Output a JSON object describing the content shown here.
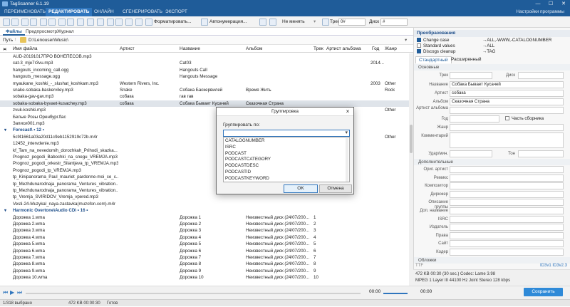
{
  "app": {
    "title": "TagScanner 6.1.19",
    "window_min": "—",
    "window_max": "☐",
    "window_close": "✕"
  },
  "menu": {
    "items": [
      "ПЕРЕИМЕНОВАТЬ",
      "РЕДАКТИРОВАТЬ",
      "ОНЛАЙН",
      "СГЕНЕРИРОВАТЬ",
      "ЭКСПОРТ"
    ],
    "active_index": 1,
    "settings": "Настройки программы"
  },
  "toolbar": {
    "format_label": "Форматировать...",
    "autonumber_label": "Автонумерация...",
    "no_change_label": "Не менять",
    "track_label": "Трек",
    "track_value": "0#",
    "disc_label": "Диск",
    "disc_value": "#"
  },
  "tabs": [
    "Файлы",
    "Предпросмотр",
    "Журнал"
  ],
  "path": {
    "label": "Путь",
    "value": "D:\\Lenouser\\Music\\"
  },
  "columns": [
    "Имя файла",
    "Артист",
    "Название",
    "Альбом",
    "Трек",
    "Артист альбома",
    "Год",
    "Жанр"
  ],
  "rows": [
    {
      "t": "f",
      "name": "AUD-20191017ПРО ВОНЕПЕСОВ.mp3",
      "artist": "",
      "title": "",
      "album": "",
      "track": "",
      "aa": "",
      "year": "",
      "genre": ""
    },
    {
      "t": "f",
      "name": "cat-3_mje7r3vu.mp3",
      "artist": "",
      "title": "Cat03",
      "album": "",
      "track": "",
      "aa": "",
      "year": "2014...",
      "genre": ""
    },
    {
      "t": "f",
      "name": "hangouts_incoming_call.ogg",
      "artist": "",
      "title": "Hangouts Call",
      "album": "",
      "track": "",
      "aa": "",
      "year": "",
      "genre": ""
    },
    {
      "t": "f",
      "name": "hangouts_message.ogg",
      "artist": "",
      "title": "Hangouts Message",
      "album": "",
      "track": "",
      "aa": "",
      "year": "",
      "genre": ""
    },
    {
      "t": "f",
      "name": "myaukane_koshki_-_slushat_koshkam.mp3",
      "artist": "Western Rivers, Inc.",
      "title": "",
      "album": "",
      "track": "",
      "aa": "",
      "year": "2003",
      "genre": "Other"
    },
    {
      "t": "f",
      "name": "snake-sobaka-baskerviley.mp3",
      "artist": "Snake",
      "title": "Собака Баскервилей",
      "album": "Время Жить",
      "track": "",
      "aa": "",
      "year": "",
      "genre": "Rock"
    },
    {
      "t": "f",
      "name": "sobaka-gav-gav.mp3",
      "artist": "собака",
      "title": "гав гав",
      "album": "",
      "track": "",
      "aa": "",
      "year": "",
      "genre": ""
    },
    {
      "t": "s",
      "name": "sobaka-sobaka-byvaet-kusachey.mp3",
      "artist": "собака",
      "title": "Собака Бывает Кусачей",
      "album": "Сказочная Страна",
      "track": "",
      "aa": "",
      "year": "",
      "genre": ""
    },
    {
      "t": "f",
      "name": "zvuk-koshki.mp3",
      "artist": "",
      "title": "",
      "album": "",
      "track": "",
      "aa": "",
      "year": "",
      "genre": "Other"
    },
    {
      "t": "f",
      "name": "Белые Розы Оренбург.flac",
      "artist": "",
      "title": "",
      "album": "",
      "track": "",
      "aa": "",
      "year": "",
      "genre": ""
    },
    {
      "t": "f",
      "name": "Записи001.mp3",
      "artist": "",
      "title": "",
      "album": "",
      "track": "",
      "aa": "",
      "year": "",
      "genre": ""
    },
    {
      "t": "g",
      "name": "Forecast\\ • 12 •",
      "artist": "",
      "title": "",
      "album": "",
      "track": "",
      "aa": "",
      "year": "",
      "genre": ""
    },
    {
      "t": "f",
      "name": "5cf41661a03a20d11c9eb1152919c72b.m4r",
      "artist": "",
      "title": "",
      "album": "",
      "track": "",
      "aa": "",
      "year": "",
      "genre": "Other"
    },
    {
      "t": "f",
      "name": "12452_intervdenie.mp3",
      "artist": "",
      "title": "",
      "album": "",
      "track": "",
      "aa": "",
      "year": "",
      "genre": ""
    },
    {
      "t": "f",
      "name": "kf_Tam_na_nevedomih_dorozhkah_Prihodi_skazka...",
      "artist": "",
      "title": "",
      "album": "",
      "track": "",
      "aa": "",
      "year": "",
      "genre": ""
    },
    {
      "t": "f",
      "name": "Prognoz_pogodi_Babochki_na_snegu_VREMJA.mp3",
      "artist": "",
      "title": "",
      "album": "",
      "track": "",
      "aa": "",
      "year": "",
      "genre": ""
    },
    {
      "t": "f",
      "name": "Prognoz_pogodi_orkestr_Silantjeva_tp_VREMJA.mp3",
      "artist": "",
      "title": "",
      "album": "",
      "track": "",
      "aa": "",
      "year": "",
      "genre": ""
    },
    {
      "t": "f",
      "name": "Prognoz_pogodi_tp_VREMJA.mp3",
      "artist": "",
      "title": "",
      "album": "",
      "track": "",
      "aa": "",
      "year": "",
      "genre": ""
    },
    {
      "t": "f",
      "name": "tp_Kinipanorama_Paul_mauriet_pardonne-moi_ce_c...",
      "artist": "",
      "title": "",
      "album": "",
      "track": "",
      "aa": "",
      "year": "",
      "genre": ""
    },
    {
      "t": "f",
      "name": "tp_Mezhdunarodnaja_panorama_Ventures_vibration...",
      "artist": "",
      "title": "",
      "album": "",
      "track": "",
      "aa": "",
      "year": "",
      "genre": ""
    },
    {
      "t": "f",
      "name": "tp_Mezhdunarodnaja_panorama_Ventures_vibration...",
      "artist": "",
      "title": "",
      "album": "",
      "track": "",
      "aa": "",
      "year": "",
      "genre": ""
    },
    {
      "t": "f",
      "name": "tp_Vremja_SVIRIDOV_Vremja_vpered.mp3",
      "artist": "",
      "title": "",
      "album": "",
      "track": "",
      "aa": "",
      "year": "",
      "genre": ""
    },
    {
      "t": "f",
      "name": "Vesti-24-Muzykal_naya-zastavka(muzofon.com).m4r",
      "artist": "",
      "title": "",
      "album": "",
      "track": "",
      "aa": "",
      "year": "",
      "genre": ""
    },
    {
      "t": "g",
      "name": "Harmonic Overtone\\Audio CD\\ • 16 •",
      "artist": "",
      "title": "",
      "album": "",
      "track": "",
      "aa": "",
      "year": "",
      "genre": ""
    },
    {
      "t": "f",
      "name": "Дорожка 1.wma",
      "artist": "",
      "title": "Дорожка 1",
      "album": "Неизвестный диск (24/07/200...",
      "track": "1",
      "aa": "",
      "year": "",
      "genre": ""
    },
    {
      "t": "f",
      "name": "Дорожка 2.wma",
      "artist": "",
      "title": "Дорожка 2",
      "album": "Неизвестный диск (24/07/200...",
      "track": "2",
      "aa": "",
      "year": "",
      "genre": ""
    },
    {
      "t": "f",
      "name": "Дорожка 3.wma",
      "artist": "",
      "title": "Дорожка 3",
      "album": "Неизвестный диск (24/07/200...",
      "track": "3",
      "aa": "",
      "year": "",
      "genre": ""
    },
    {
      "t": "f",
      "name": "Дорожка 4.wma",
      "artist": "",
      "title": "Дорожка 4",
      "album": "Неизвестный диск (24/07/200...",
      "track": "4",
      "aa": "",
      "year": "",
      "genre": ""
    },
    {
      "t": "f",
      "name": "Дорожка 5.wma",
      "artist": "",
      "title": "Дорожка 5",
      "album": "Неизвестный диск (24/07/200...",
      "track": "5",
      "aa": "",
      "year": "",
      "genre": ""
    },
    {
      "t": "f",
      "name": "Дорожка 6.wma",
      "artist": "",
      "title": "Дорожка 6",
      "album": "Неизвестный диск (24/07/200...",
      "track": "6",
      "aa": "",
      "year": "",
      "genre": ""
    },
    {
      "t": "f",
      "name": "Дорожка 7.wma",
      "artist": "",
      "title": "Дорожка 7",
      "album": "Неизвестный диск (24/07/200...",
      "track": "7",
      "aa": "",
      "year": "",
      "genre": ""
    },
    {
      "t": "f",
      "name": "Дорожка 8.wma",
      "artist": "",
      "title": "Дорожка 8",
      "album": "Неизвестный диск (24/07/200...",
      "track": "8",
      "aa": "",
      "year": "",
      "genre": ""
    },
    {
      "t": "f",
      "name": "Дорожка 9.wma",
      "artist": "",
      "title": "Дорожка 9",
      "album": "Неизвестный диск (24/07/200...",
      "track": "9",
      "aa": "",
      "year": "",
      "genre": ""
    },
    {
      "t": "f",
      "name": "Дорожка 10.wma",
      "artist": "",
      "title": "Дорожка 10",
      "album": "Неизвестный диск (24/07/200...",
      "track": "10",
      "aa": "",
      "year": "",
      "genre": ""
    }
  ],
  "right": {
    "transform_header": "Преобразования",
    "transforms": [
      {
        "on": true,
        "name": "Change case",
        "val": "→ALL,-WWW,-CATALOGNUMBER"
      },
      {
        "on": false,
        "name": "Standard values",
        "val": "→ALL"
      },
      {
        "on": true,
        "name": "Discogs cleanup",
        "val": "→TAG"
      }
    ],
    "tabs": [
      "Стандартный",
      "Расширенный"
    ],
    "section_basic": "Основные",
    "fields": [
      {
        "label": "Трек",
        "value": ""
      },
      {
        "label": "Название",
        "value": "Собака Бывает Кусачей"
      },
      {
        "label": "Артист",
        "value": "собака"
      },
      {
        "label": "Альбом",
        "value": "Сказочная Страна"
      },
      {
        "label": "Артист альбома",
        "value": ""
      },
      {
        "label": "Год",
        "value": ""
      },
      {
        "label": "Жанр",
        "value": ""
      },
      {
        "label": "Комментарий",
        "value": ""
      }
    ],
    "disc_label": "Диск",
    "compilation_label": "Часть сборника",
    "bpm_label": "Удар/мин.",
    "key_label": "Тон",
    "section_extra": "Дополнительные",
    "extra_fields": [
      "Ориг. артист",
      "Ремикс",
      "Композитор",
      "Дирижер",
      "Описание группы",
      "Доп. название",
      "ISRC",
      "Издатель",
      "Права",
      "Сайт",
      "Кодер"
    ],
    "section_covers": "Обложки",
    "tag_label": "TTF",
    "file_info_1": "472 KB  00:30 (30 sec.)  Codec: Lame 3.98",
    "file_info_2": "MPEG 1 Layer III  44100 Hz  Joint Stereo  128 kbps",
    "id3_label": "ID3v1  ID3v2.3"
  },
  "player": {
    "time": "00:00"
  },
  "save_label": "Сохранить",
  "status": {
    "selected": "1/318 выбрано",
    "size": "472 KB  00:00:30",
    "ready": "Готов"
  },
  "dialog": {
    "title": "Группировка",
    "label": "Группировать по:",
    "options": [
      "CATALOGNUMBER",
      "ISRC",
      "PODCAST",
      "PODCASTCATEGORY",
      "PODCASTDESC",
      "PODCASTID",
      "PODCASTKEYWORD"
    ],
    "ok": "OK",
    "cancel": "Отмена"
  },
  "colors": {
    "accent": "#1f5c99",
    "save": "#2f8ad8",
    "selected_row": "#dfe4ea"
  }
}
